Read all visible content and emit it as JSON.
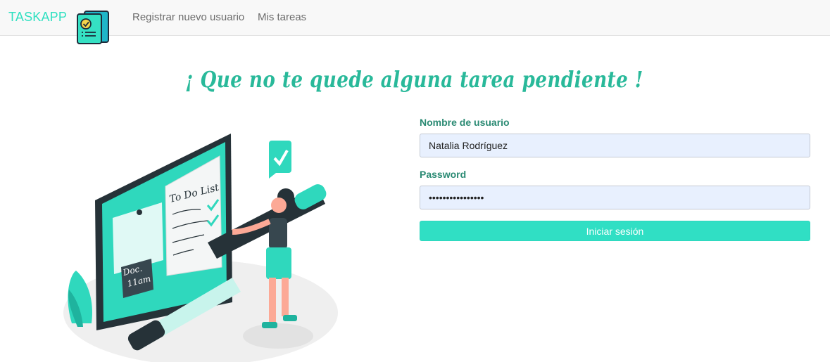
{
  "navbar": {
    "brand": "TASKAPP",
    "links": [
      {
        "label": "Registrar nuevo usuario"
      },
      {
        "label": "Mis tareas"
      }
    ]
  },
  "headline": "¡ Que no te quede alguna tarea pendiente !",
  "illustration": {
    "board_title": "To Do List",
    "note_line1": "Doc.",
    "note_line2": "11am"
  },
  "login_form": {
    "username_label": "Nombre de usuario",
    "username_value": "Natalia Rodríguez",
    "password_label": "Password",
    "password_value": "••••••••••••••••",
    "submit_label": "Iniciar sesión"
  },
  "colors": {
    "brand": "#2fe0c1",
    "accent": "#30dfc4",
    "headline": "#29b99a",
    "label": "#2a8a73",
    "input_bg": "#e8f0fe"
  }
}
